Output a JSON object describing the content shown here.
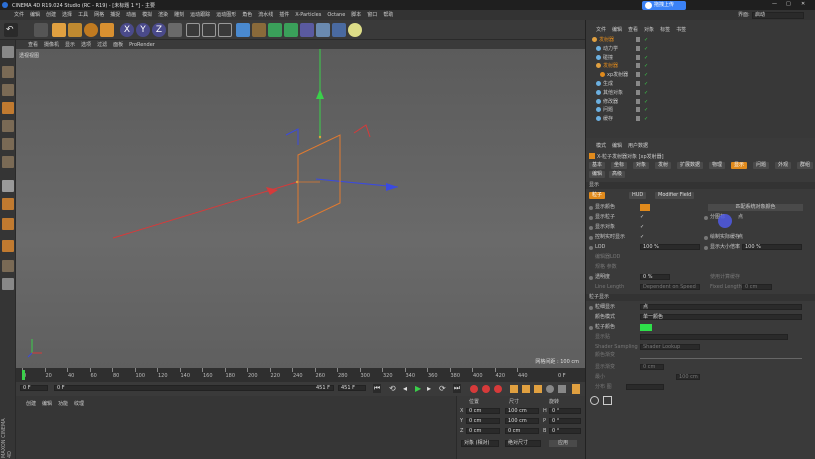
{
  "window": {
    "title": "CINEMA 4D R19.024 Studio (RC - R19) - [未标题 1 *] - 主要"
  },
  "upload_button": "拖拽上传",
  "layout": {
    "label": "界面:",
    "value": "启动"
  },
  "menu": [
    "文件",
    "编辑",
    "创建",
    "选择",
    "工具",
    "网格",
    "捕捉",
    "动画",
    "模拟",
    "渲染",
    "雕刻",
    "运动跟踪",
    "运动图形",
    "角色",
    "流水线",
    "插件",
    "X-Particles",
    "Octane",
    "脚本",
    "窗口",
    "帮助"
  ],
  "toolbar": {
    "x_label": "X",
    "y_label": "Y",
    "z_label": "Z"
  },
  "viewport": {
    "menu": [
      "查看",
      "摄像机",
      "显示",
      "选项",
      "过滤",
      "面板",
      "ProRender"
    ],
    "name": "透视视图",
    "grid_spacing": "网格间距 : 100 cm"
  },
  "timeline": {
    "ticks": [
      "0",
      "20",
      "40",
      "60",
      "80",
      "100",
      "120",
      "140",
      "160",
      "180",
      "200",
      "220",
      "240",
      "260",
      "280",
      "300",
      "320",
      "340",
      "360",
      "380",
      "400",
      "420",
      "440"
    ],
    "right_frame": "0 F",
    "start": "0 F",
    "current": "0 F",
    "end": "451 F",
    "end_field": "451 F"
  },
  "materials": {
    "menu": [
      "创建",
      "编辑",
      "功能",
      "纹理"
    ]
  },
  "coords": {
    "headers": [
      "位置",
      "尺寸",
      "旋转"
    ],
    "rows": [
      {
        "axis": "X",
        "pos": "0 cm",
        "size": "100 cm",
        "rot_axis": "H",
        "rot": "0 °"
      },
      {
        "axis": "Y",
        "pos": "0 cm",
        "size": "100 cm",
        "rot_axis": "P",
        "rot": "0 °"
      },
      {
        "axis": "Z",
        "pos": "0 cm",
        "size": "0 cm",
        "rot_axis": "B",
        "rot": "0 °"
      }
    ],
    "mode_select": "对象 (相对)",
    "size_select": "绝对尺寸",
    "apply": "应用"
  },
  "object_manager": {
    "menu": [
      "文件",
      "编辑",
      "查看",
      "对象",
      "标签",
      "书签"
    ],
    "items": [
      {
        "label": "发射器",
        "indent": 0,
        "color": "#e0a040"
      },
      {
        "label": "动力学",
        "indent": 1,
        "color": "#6cb0e0"
      },
      {
        "label": "碰撞",
        "indent": 1,
        "color": "#6cb0e0"
      },
      {
        "label": "发射器",
        "indent": 1,
        "color": "#e0a040"
      },
      {
        "label": "xp发射器",
        "indent": 2,
        "color": "#e08a1c"
      },
      {
        "label": "生成",
        "indent": 1,
        "color": "#6cb0e0"
      },
      {
        "label": "其他对象",
        "indent": 1,
        "color": "#6cb0e0"
      },
      {
        "label": "修改器",
        "indent": 1,
        "color": "#6cb0e0"
      },
      {
        "label": "问题",
        "indent": 1,
        "color": "#6cb0e0"
      },
      {
        "label": "缓存",
        "indent": 1,
        "color": "#6cb0e0"
      }
    ]
  },
  "attributes": {
    "menu": [
      "模式",
      "编辑",
      "用户数据"
    ],
    "object_title": "X-粒子发射器对象 [xp发射器]",
    "tabs_row1": [
      "基本",
      "坐标",
      "对象",
      "发射",
      "扩展数据",
      "物理",
      "显示",
      "问题",
      "外观",
      "群组"
    ],
    "tabs_row2": [
      "编辑",
      "高级"
    ],
    "section_display": "显示",
    "subtabs": [
      "粒子",
      "HUD",
      "Modifier Field"
    ],
    "rows": {
      "particle_color": "显示颜色",
      "match_color": "匹配系统对象颜色",
      "show_particles": "显示粒子",
      "show_emitter": "显示对象",
      "control_lod": "控制实时显示",
      "lod": "LOD",
      "lod_value": "100 %",
      "editor_lod": "编辑器LOD",
      "spec_gen": "规格 参数",
      "transparency": "透明度",
      "trans_value": "0 %",
      "line_length": "Line Length",
      "line_length_sel": "Dependent on Speed",
      "fixed_length": "Fixed Length",
      "fixed_length_val": "0 cm",
      "r_inst": "分图标",
      "r_inst_val": "点",
      "r_control": "绘制实际缓存",
      "r_control_val": "点",
      "r_display_size": "显示大小倍率",
      "r_display_size_val": "100 %",
      "r_use_vfx": "使用计算缓存"
    },
    "section_particle": "粒子显示",
    "particle_rows": {
      "display": "粒细显示",
      "display_val": "点",
      "color_mode": "颜色模式",
      "color_mode_val": "单一颜色",
      "particle_color": "粒子颜色",
      "tex": "显示贴",
      "shader_sampling": "Shader Sampling",
      "shader_val": "Shader Lookup",
      "density": "颜色渐变",
      "show_uv": "显示渐变",
      "show_uv_val": "0 cm",
      "max_size": "最小",
      "max_size_val": "100 cm",
      "range": "分布 图"
    }
  },
  "colors": {
    "accent": "#e08a1c",
    "axis_x": "#d63a3a",
    "axis_y": "#3ad04a",
    "axis_z": "#3a4ae0",
    "emitter_plane": "#e07a30",
    "particle_color": "#2ee04a",
    "upload_btn": "#3b82f6"
  }
}
